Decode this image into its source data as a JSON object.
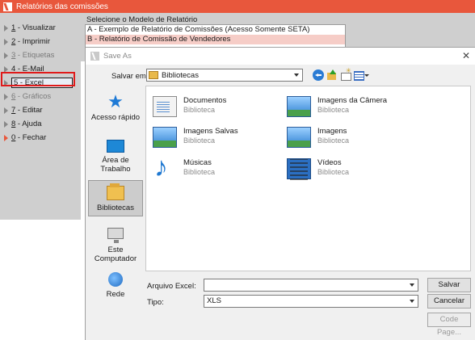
{
  "app": {
    "title": "Relatórios das comissões"
  },
  "sidebar": {
    "items": [
      {
        "key": "1",
        "rest": " - Visualizar",
        "disabled": false
      },
      {
        "key": "2",
        "rest": " - Imprimir",
        "disabled": false
      },
      {
        "key": "3",
        "rest": " - Etiquetas",
        "disabled": true
      },
      {
        "key": "4",
        "rest": " - E-Mail",
        "disabled": false
      },
      {
        "key": "5",
        "rest": " - Excel",
        "disabled": false
      },
      {
        "key": "6",
        "rest": " - Gráficos",
        "disabled": true
      },
      {
        "key": "7",
        "rest": " - Editar",
        "disabled": false
      },
      {
        "key": "8",
        "rest": " - Ajuda",
        "disabled": false
      },
      {
        "key": "0",
        "rest": " - Fechar",
        "disabled": false
      }
    ]
  },
  "report": {
    "label": "Selecione o Modelo de Relatório",
    "items": [
      "A - Exemplo de Relatório de Comissões (Acesso Somente SETA)",
      "B - Relatório de Comissão de Vendedores"
    ]
  },
  "dialog": {
    "title": "Save As",
    "save_in_label": "Salvar em:",
    "save_in_value": "Bibliotecas",
    "places": [
      {
        "label": "Acesso rápido",
        "icon": "star-icon"
      },
      {
        "label": "Área de Trabalho",
        "icon": "desktop-icon"
      },
      {
        "label": "Bibliotecas",
        "icon": "library-icon"
      },
      {
        "label": "Este Computador",
        "icon": "computer-icon"
      },
      {
        "label": "Rede",
        "icon": "network-icon"
      }
    ],
    "libraries": [
      {
        "name": "Documentos",
        "type": "Biblioteca",
        "icon": "documents-icon"
      },
      {
        "name": "Imagens da Câmera",
        "type": "Biblioteca",
        "icon": "camera-images-icon"
      },
      {
        "name": "Imagens Salvas",
        "type": "Biblioteca",
        "icon": "saved-images-icon"
      },
      {
        "name": "Imagens",
        "type": "Biblioteca",
        "icon": "images-icon"
      },
      {
        "name": "Músicas",
        "type": "Biblioteca",
        "icon": "music-icon"
      },
      {
        "name": "Vídeos",
        "type": "Biblioteca",
        "icon": "videos-icon"
      }
    ],
    "filename_label": "Arquivo Excel:",
    "filename_value": "",
    "type_label": "Tipo:",
    "type_value": "XLS",
    "save_button": "Salvar",
    "cancel_button": "Cancelar",
    "codepage_button": "Code Page..."
  },
  "colors": {
    "titlebar": "#e8573c",
    "selection_highlight": "#e01a1a",
    "selected_report": "#f6cdc7"
  }
}
